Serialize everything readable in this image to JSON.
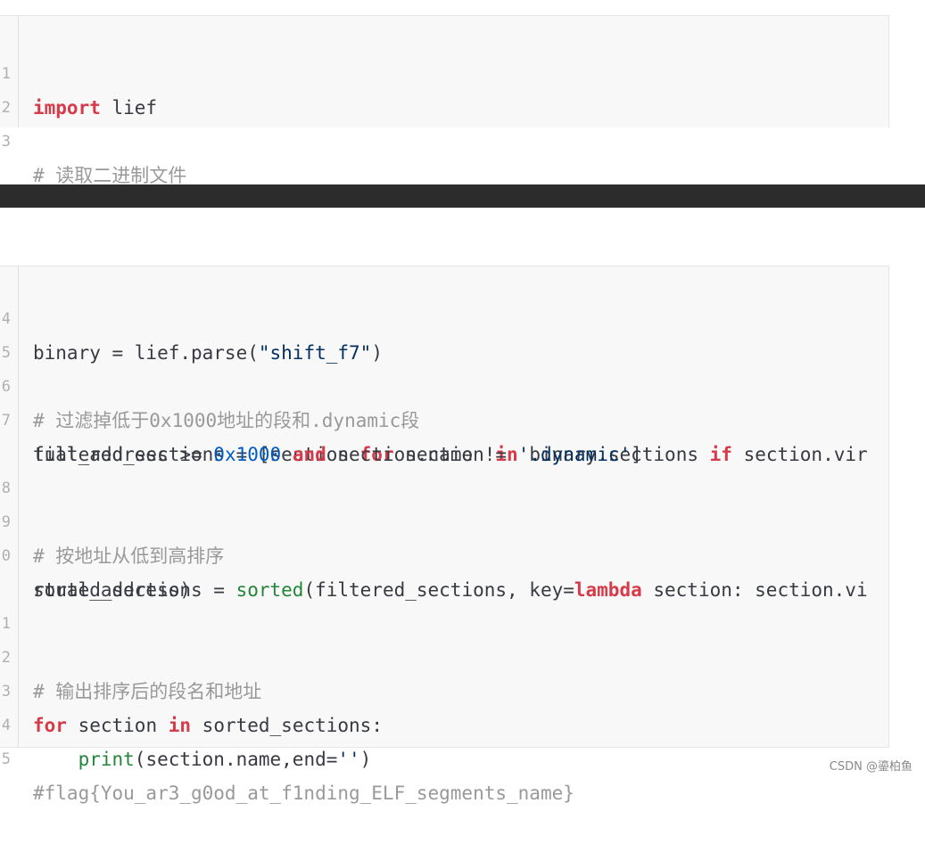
{
  "block1": {
    "lines": [
      {
        "ln": "1",
        "kw": "import",
        "rest": " lief"
      },
      {
        "ln": "2"
      },
      {
        "ln": "3",
        "comment": "# 读取二进制文件"
      }
    ]
  },
  "block2": {
    "l4": {
      "ln": "4",
      "a": "binary = lief.parse(",
      "str": "\"shift_f7\"",
      "b": ")"
    },
    "l5": {
      "ln": "5"
    },
    "l6": {
      "ln": "6",
      "comment": "# 过滤掉低于0x1000地址的段和.dynamic段"
    },
    "l7": {
      "ln": "7",
      "a": "filtered_sections = [section ",
      "kw1": "for",
      "b": " section ",
      "kw2": "in",
      "c": " binary.sections ",
      "kw3": "if",
      "d": " section.vir"
    },
    "l7b": {
      "a": "tual_address >= ",
      "num": "0x1000",
      "b": " ",
      "kw": "and",
      "c": " section.name != ",
      "str": "'.dynamic'",
      "d": "]"
    },
    "l8": {
      "ln": "8"
    },
    "l9": {
      "ln": "9",
      "comment": "# 按地址从低到高排序"
    },
    "l10": {
      "ln": "0",
      "a": "sorted_sections = ",
      "fn": "sorted",
      "b": "(filtered_sections, key=",
      "kw": "lambda",
      "c": " section: section.vi"
    },
    "l10b": {
      "a": "rtual_address)"
    },
    "l11": {
      "ln": "1"
    },
    "l12": {
      "ln": "2",
      "comment": "# 输出排序后的段名和地址"
    },
    "l13": {
      "ln": "3",
      "kw1": "for",
      "a": " section ",
      "kw2": "in",
      "b": " sorted_sections:"
    },
    "l14": {
      "ln": "4",
      "indent": "    ",
      "fn": "print",
      "a": "(section.name,end=",
      "str": "''",
      "b": ")"
    },
    "l15": {
      "ln": "5",
      "comment": "#flag{You_ar3_g0od_at_f1nding_ELF_segments_name}"
    }
  },
  "watermark": "CSDN @鎏柏鱼",
  "colors": {
    "keyword": "#d73a49",
    "string": "#032f62",
    "number": "#005cc5",
    "builtin": "#22863a",
    "comment": "#999999",
    "code_bg": "#f8f8f8",
    "divider": "#2c2c2c"
  }
}
